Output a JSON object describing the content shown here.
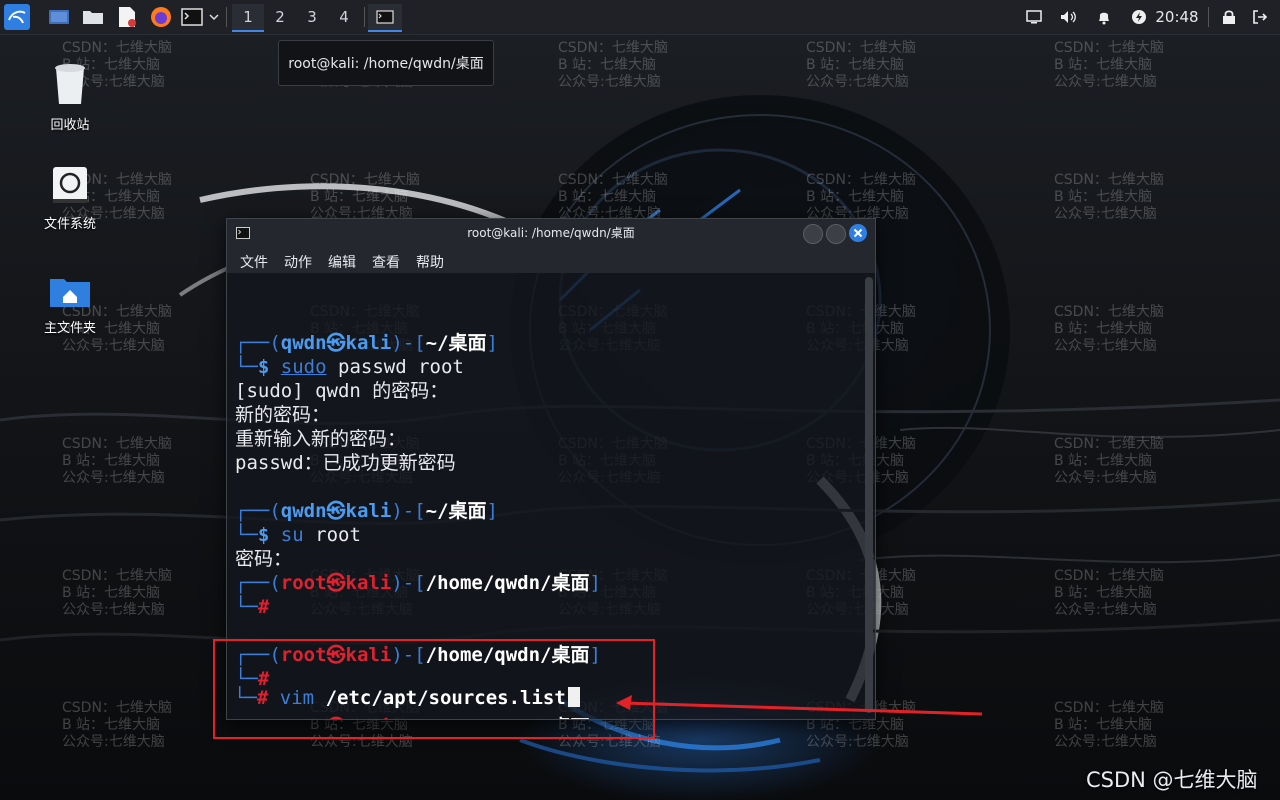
{
  "taskbar": {
    "workspaces": [
      "1",
      "2",
      "3",
      "4"
    ],
    "active_workspace": "1",
    "clock": "20:48"
  },
  "tooltip": {
    "text": "root@kali: /home/qwdn/桌面"
  },
  "desktop_icons": [
    {
      "label": "回收站",
      "icon": "trash-icon"
    },
    {
      "label": "文件系统",
      "icon": "drive-icon"
    },
    {
      "label": "主文件夹",
      "icon": "home-folder-icon"
    }
  ],
  "watermark": {
    "line1": "CSDN：七维大脑",
    "line2": "B 站：七维大脑",
    "line3": "公众号:七维大脑"
  },
  "terminal": {
    "title": "root@kali: /home/qwdn/桌面",
    "menu": [
      "文件",
      "动作",
      "编辑",
      "查看",
      "帮助"
    ],
    "prompt_user": "qwdn",
    "prompt_root": "root",
    "host": "kali",
    "at_symbol": "㉿",
    "home_dir": "~/桌面",
    "root_dir": "/home/qwdn/桌面",
    "cmd_passwd_sudo": "sudo",
    "cmd_passwd_rest": "passwd root",
    "out_sudo_prompt": "[sudo] qwdn 的密码：",
    "out_new_pw": "新的密码：",
    "out_retype_pw": "重新输入新的密码：",
    "out_success": "passwd：已成功更新密码",
    "cmd_su_bin": "su",
    "cmd_su_arg": "root",
    "out_password": "密码：",
    "cmd_vim_bin": "vim",
    "cmd_vim_arg": "/etc/apt/sources.list",
    "dollar": "$",
    "hash": "#"
  },
  "corner_watermark": "CSDN @七维大脑",
  "colors": {
    "accent": "#3f86e6",
    "prompt_blue": "#4b9cf0",
    "prompt_red": "#e0212f",
    "annotation_red": "#e32228"
  }
}
